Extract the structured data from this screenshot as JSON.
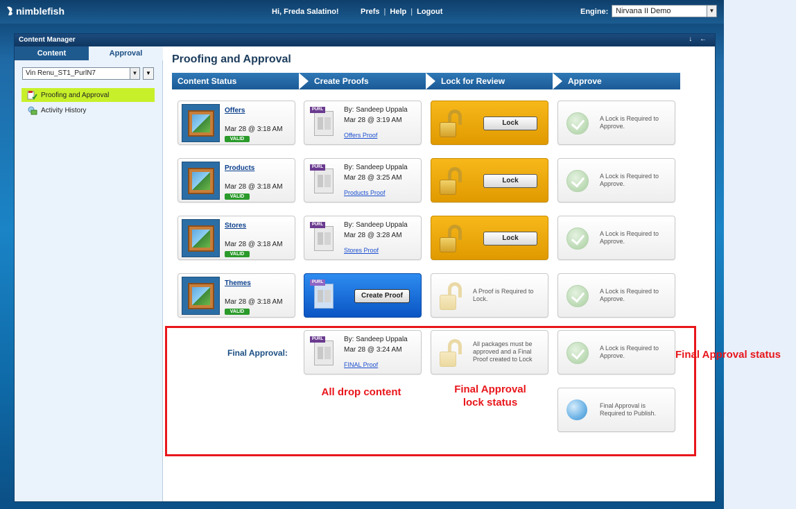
{
  "app": {
    "logo_text": "nimblefish",
    "greeting": "Hi, Freda Salatino!",
    "top_links": [
      "Prefs",
      "Help",
      "Logout"
    ],
    "engine_label": "Engine:",
    "engine_value": "Nirvana II Demo"
  },
  "panel": {
    "title": "Content Manager",
    "controls": "↓ ←"
  },
  "sidebar": {
    "tabs": [
      "Content",
      "Approval"
    ],
    "campaign_value": "Vin Renu_ST1_PurlN7",
    "items": [
      {
        "label": "Proofing and Approval",
        "active": true
      },
      {
        "label": "Activity History",
        "active": false
      }
    ]
  },
  "main": {
    "title": "Proofing and Approval",
    "steps": [
      "Content Status",
      "Create Proofs",
      "Lock for Review",
      "Approve"
    ],
    "rows": [
      {
        "content": {
          "name": "Offers",
          "date": "Mar 28 @ 3:18 AM",
          "badge": "VALID"
        },
        "proof": {
          "by": "By: Sandeep Uppala",
          "date": "Mar 28 @ 3:19 AM",
          "link": "Offers Proof",
          "tag": "PURL"
        },
        "lock": {
          "state": "active",
          "button": "Lock"
        },
        "approve": {
          "text": "A Lock is Required to Approve."
        }
      },
      {
        "content": {
          "name": "Products",
          "date": "Mar 28 @ 3:18 AM",
          "badge": "VALID"
        },
        "proof": {
          "by": "By: Sandeep Uppala",
          "date": "Mar 28 @ 3:25 AM",
          "link": "Products Proof",
          "tag": "PURL"
        },
        "lock": {
          "state": "active",
          "button": "Lock"
        },
        "approve": {
          "text": "A Lock is Required to Approve."
        }
      },
      {
        "content": {
          "name": "Stores",
          "date": "Mar 28 @ 3:18 AM",
          "badge": "VALID"
        },
        "proof": {
          "by": "By: Sandeep Uppala",
          "date": "Mar 28 @ 3:28 AM",
          "link": "Stores Proof",
          "tag": "PURL"
        },
        "lock": {
          "state": "active",
          "button": "Lock"
        },
        "approve": {
          "text": "A Lock is Required to Approve."
        }
      },
      {
        "content": {
          "name": "Themes",
          "date": "Mar 28 @ 3:18 AM",
          "badge": "VALID"
        },
        "proof": {
          "create_button": "Create Proof",
          "tag": "PURL"
        },
        "lock": {
          "state": "disabled",
          "text": "A Proof is Required to Lock."
        },
        "approve": {
          "text": "A Lock is Required to Approve."
        }
      }
    ],
    "final": {
      "label": "Final Approval:",
      "proof": {
        "by": "By: Sandeep Uppala",
        "date": "Mar 28 @ 3:24 AM",
        "link": "FINAL Proof",
        "tag": "PURL"
      },
      "lock_text": "All packages must be approved and a Final Proof created to Lock",
      "approve_text": "A Lock is Required to Approve.",
      "publish_text": "Final Approval is Required to Publish."
    }
  },
  "annotations": {
    "all_drop_content": "All drop content",
    "final_lock_status": "Final Approval lock status",
    "final_approval_status": "Final Approval status"
  },
  "colors": {
    "accent": "#1f5a8f",
    "active_nav": "#c8f02a",
    "lock_active": "#f0a800",
    "create_proof": "#1a6ee0",
    "annotation": "#e8161b"
  }
}
